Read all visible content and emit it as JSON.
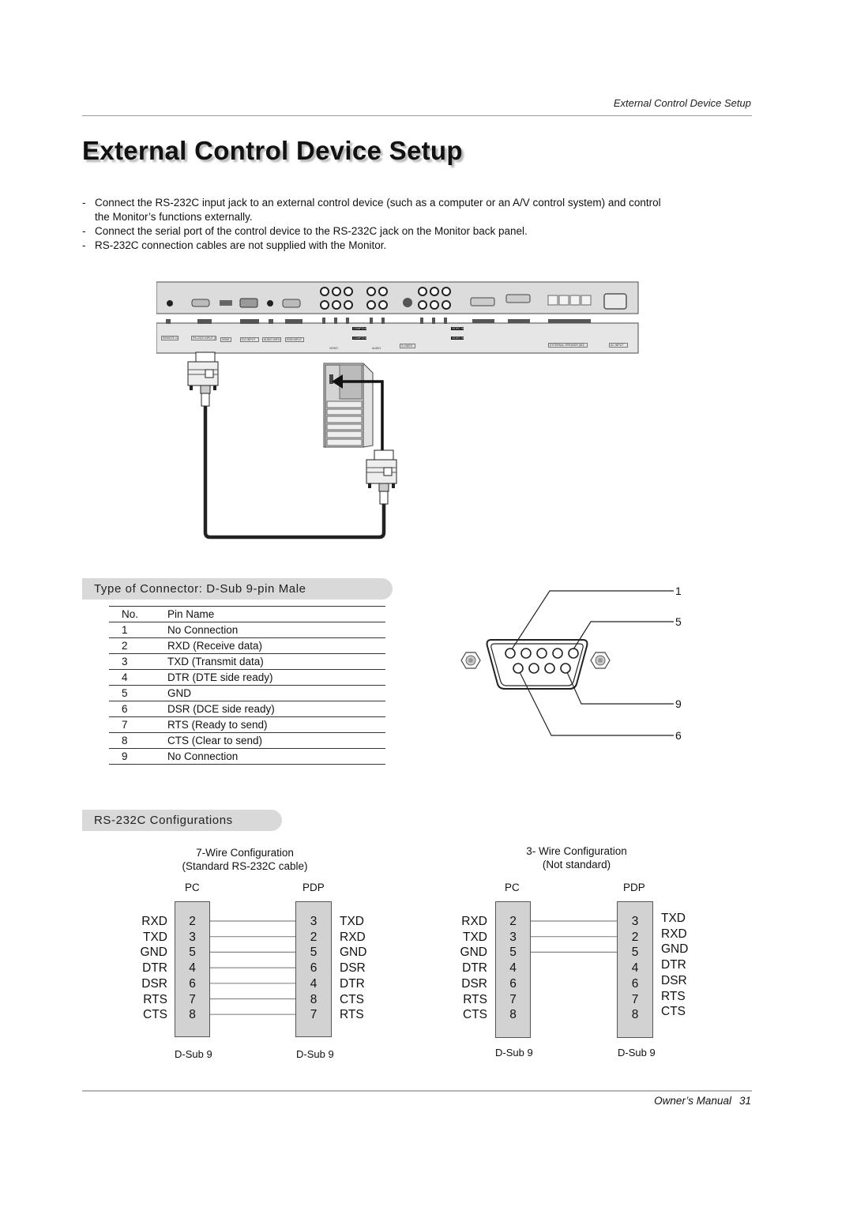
{
  "header": {
    "running_title": "External Control Device Setup"
  },
  "page_title": "External Control Device Setup",
  "instructions": [
    {
      "dash": "-",
      "text": "Connect the RS-232C input jack to an external control device (such as a computer or an A/V control system) and control the Monitor’s functions externally."
    },
    {
      "dash": "-",
      "text": "Connect the serial port of the control device to the RS-232C jack on the Monitor back panel."
    },
    {
      "dash": "-",
      "text": "RS-232C connection cables are not supplied with the Monitor."
    }
  ],
  "back_panel": {
    "labels": {
      "remote": "REMOTE CONTROL",
      "rs232c": "RS-232C INPUT (CONTROL/SERVICE)",
      "hdmi": "HDMI",
      "dvi": "DVI INPUT",
      "audio": "AUDIO INPUT",
      "rgb": "RGB INPUT",
      "component2": "COMPONENT INPUT 2",
      "component1": "COMPONENT INPUT 1",
      "video_group": "VIDEO",
      "audio_group": "AUDIO",
      "svideo": "S-VIDEO",
      "video_in2": "VIDEO INPUT 2",
      "video_in1": "VIDEO INPUT 1",
      "audio_mono": "MONO",
      "audio2": "AUDIO",
      "video2": "VIDEO",
      "ext_speaker": "EXTERNAL SPEAKER (8Ω)",
      "ac_input": "AC INPUT"
    }
  },
  "connector_section": {
    "heading": "Type of Connector: D-Sub 9-pin Male",
    "table": {
      "headers": [
        "No.",
        "Pin Name"
      ],
      "rows": [
        [
          "1",
          "No Connection"
        ],
        [
          "2",
          "RXD (Receive data)"
        ],
        [
          "3",
          "TXD (Transmit data)"
        ],
        [
          "4",
          "DTR (DTE side ready)"
        ],
        [
          "5",
          "GND"
        ],
        [
          "6",
          "DSR (DCE side ready)"
        ],
        [
          "7",
          "RTS (Ready to send)"
        ],
        [
          "8",
          "CTS (Clear to send)"
        ],
        [
          "9",
          "No Connection"
        ]
      ]
    },
    "diagram_callouts": [
      "1",
      "5",
      "9",
      "6"
    ]
  },
  "configs_section": {
    "heading": "RS-232C Configurations",
    "configs": [
      {
        "title_line1": "7-Wire Configuration",
        "title_line2": "(Standard RS-232C cable)",
        "left_end": "PC",
        "right_end": "PDP",
        "left_signals": [
          "RXD",
          "TXD",
          "GND",
          "DTR",
          "DSR",
          "RTS",
          "CTS"
        ],
        "left_pins": [
          "2",
          "3",
          "5",
          "4",
          "6",
          "7",
          "8"
        ],
        "right_pins": [
          "3",
          "2",
          "5",
          "6",
          "4",
          "8",
          "7"
        ],
        "right_signals": [
          "TXD",
          "RXD",
          "GND",
          "DSR",
          "DTR",
          "CTS",
          "RTS"
        ],
        "wired_rows": 7,
        "left_connector": "D-Sub 9",
        "right_connector": "D-Sub 9"
      },
      {
        "title_line1": "3- Wire Configuration",
        "title_line2": "(Not standard)",
        "left_end": "PC",
        "right_end": "PDP",
        "left_signals": [
          "RXD",
          "TXD",
          "GND",
          "DTR",
          "DSR",
          "RTS",
          "CTS"
        ],
        "left_pins": [
          "2",
          "3",
          "5",
          "4",
          "6",
          "7",
          "8"
        ],
        "right_pins": [
          "3",
          "2",
          "5",
          "4",
          "6",
          "7",
          "8"
        ],
        "right_signals": [
          "TXD",
          "RXD",
          "GND",
          "DTR",
          "DSR",
          "RTS",
          "CTS"
        ],
        "wired_rows": 3,
        "left_connector": "D-Sub 9",
        "right_connector": "D-Sub 9"
      }
    ]
  },
  "footer": {
    "label": "Owner’s Manual",
    "page_number": "31"
  }
}
